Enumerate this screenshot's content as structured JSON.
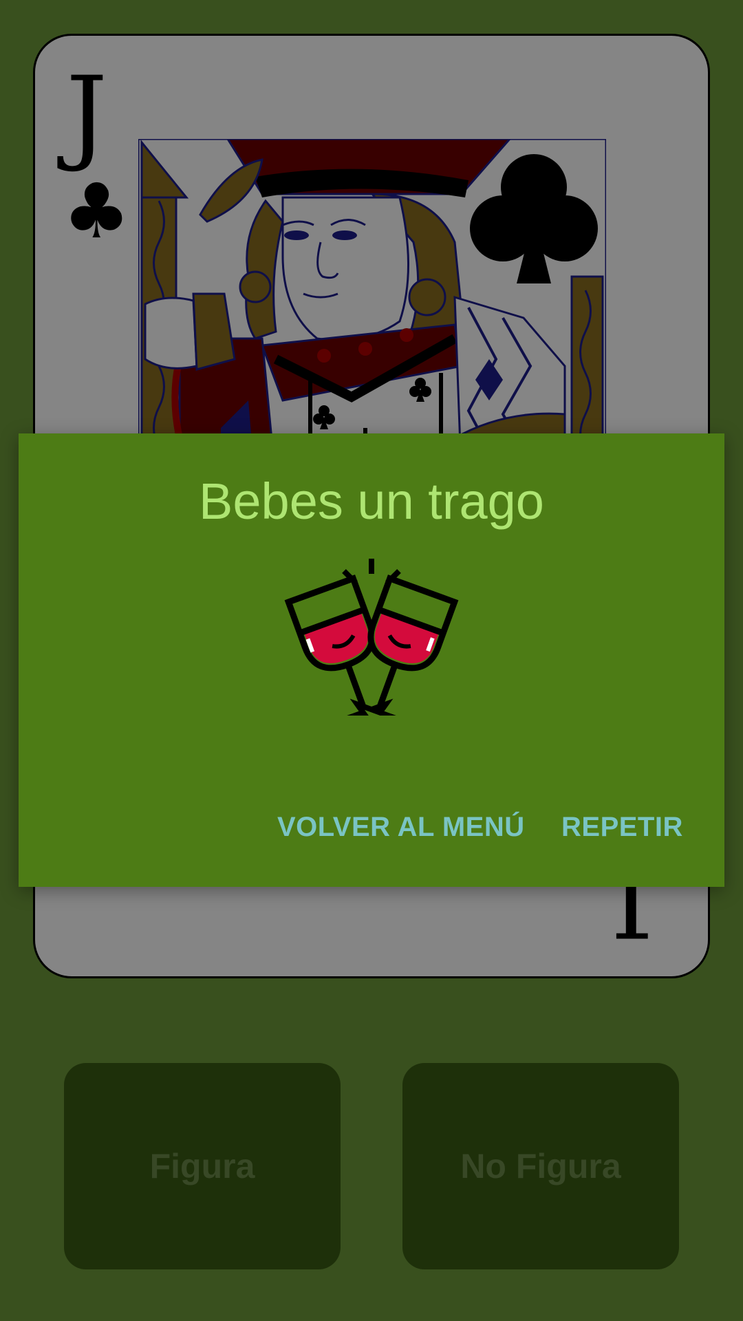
{
  "card": {
    "rank": "J",
    "suit_symbol": "♣",
    "suit": "clubs",
    "colors": {
      "gold": "#8a6d1f",
      "red": "#6b0000",
      "bright_red": "#b00000",
      "blue": "#1e1e8c",
      "black": "#000000"
    }
  },
  "buttons": {
    "figura_label": "Figura",
    "no_figura_label": "No Figura"
  },
  "dialog": {
    "title": "Bebes un trago",
    "icon": "wine-glasses-toast-icon",
    "actions": {
      "menu_label": "VOLVER AL MENÚ",
      "repeat_label": "REPETIR"
    }
  },
  "colors": {
    "background": "#6d9a3a",
    "dialog_bg": "#4d7c15",
    "dialog_title": "#aee572",
    "dialog_action": "#7ac4c4",
    "button_bg": "#3a5c14",
    "button_text": "#6b8a4a",
    "wine": "#d40b3c"
  }
}
